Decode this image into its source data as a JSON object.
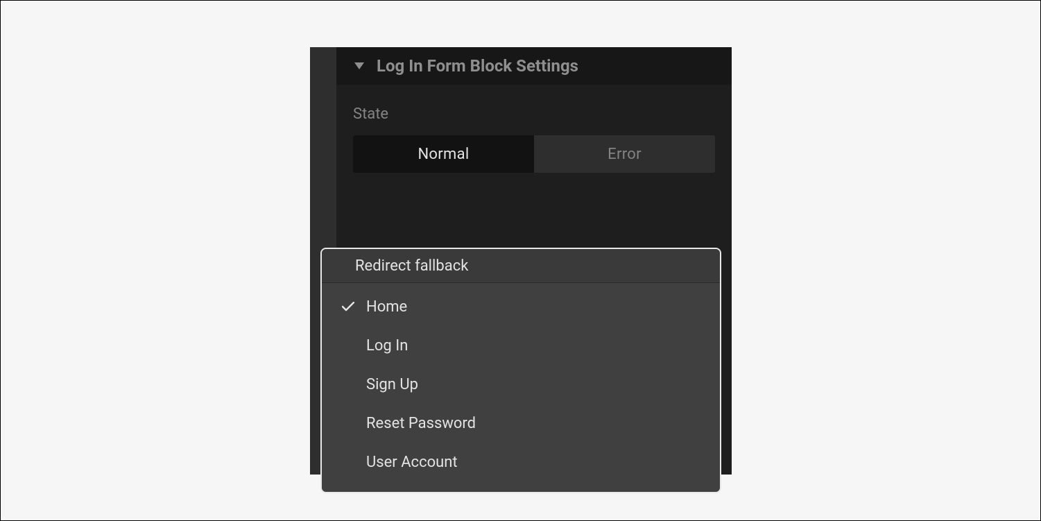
{
  "panel": {
    "title": "Log In Form Block Settings",
    "state_label": "State",
    "state_options": {
      "normal": "Normal",
      "error": "Error"
    }
  },
  "dropdown": {
    "header": "Redirect fallback",
    "items": [
      {
        "label": "Home",
        "selected": true
      },
      {
        "label": "Log In",
        "selected": false
      },
      {
        "label": "Sign Up",
        "selected": false
      },
      {
        "label": "Reset Password",
        "selected": false
      },
      {
        "label": "User Account",
        "selected": false
      }
    ]
  }
}
